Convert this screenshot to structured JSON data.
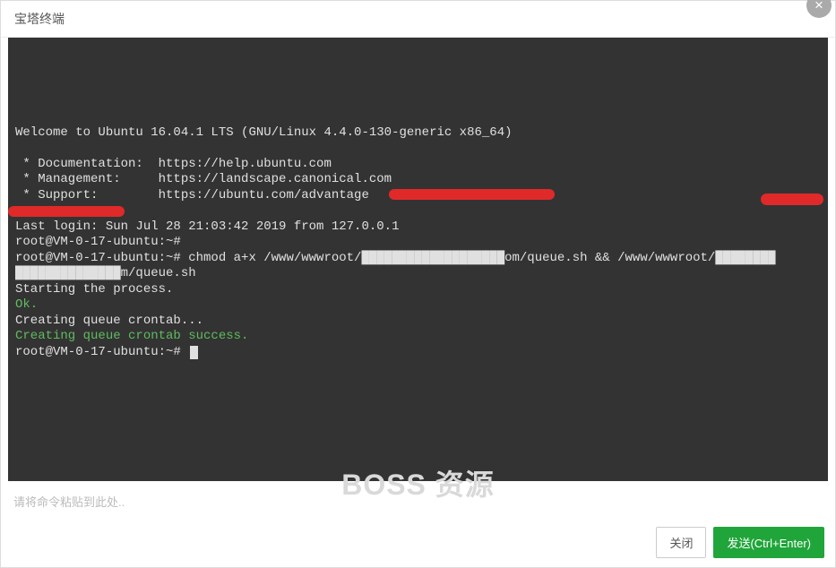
{
  "header": {
    "title": "宝塔终端",
    "close_label": "×"
  },
  "terminal": {
    "lines": [
      {
        "text": "Welcome to Ubuntu 16.04.1 LTS (GNU/Linux 4.4.0-130-generic x86_64)",
        "class": ""
      },
      {
        "text": "",
        "class": ""
      },
      {
        "text": " * Documentation:  https://help.ubuntu.com",
        "class": ""
      },
      {
        "text": " * Management:     https://landscape.canonical.com",
        "class": ""
      },
      {
        "text": " * Support:        https://ubuntu.com/advantage",
        "class": ""
      },
      {
        "text": "",
        "class": ""
      },
      {
        "text": "Last login: Sun Jul 28 21:03:42 2019 from 127.0.0.1",
        "class": ""
      },
      {
        "text": "root@VM-0-17-ubuntu:~# ",
        "class": ""
      },
      {
        "text": "root@VM-0-17-ubuntu:~# chmod a+x /www/wwwroot/███████████████████om/queue.sh && /www/wwwroot/████████",
        "class": ""
      },
      {
        "text": "██████████████m/queue.sh",
        "class": ""
      },
      {
        "text": "Starting the process.",
        "class": ""
      },
      {
        "text": "Ok.",
        "class": "term-green"
      },
      {
        "text": "Creating queue crontab...",
        "class": ""
      },
      {
        "text": "Creating queue crontab success.",
        "class": "term-green"
      },
      {
        "text": "root@VM-0-17-ubuntu:~# ",
        "class": "",
        "cursor": true
      }
    ]
  },
  "watermark": "BOSS 资源",
  "input": {
    "placeholder": "请将命令粘贴到此处..",
    "value": ""
  },
  "footer": {
    "close_label": "关闭",
    "send_label": "发送(Ctrl+Enter)"
  }
}
